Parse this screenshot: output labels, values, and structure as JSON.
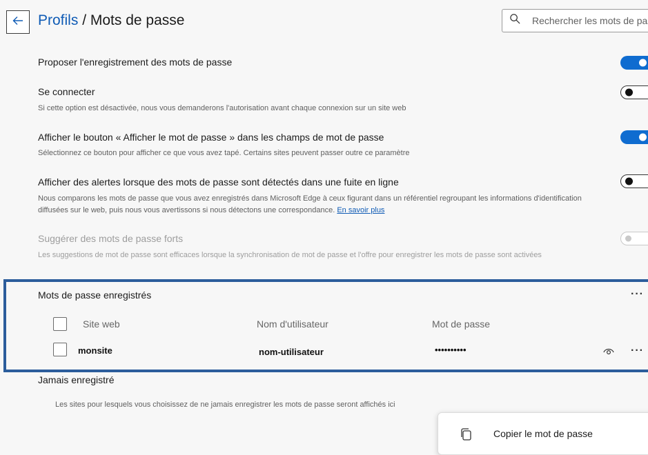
{
  "header": {
    "breadcrumb_link": "Profils",
    "breadcrumb_sep": " / ",
    "title": "Mots de passe",
    "search_placeholder": "Rechercher les mots de passe"
  },
  "settings": [
    {
      "title": "Proposer l'enregistrement des mots de passe",
      "state": "on"
    },
    {
      "title": "Se connecter",
      "description": "Si cette option est désactivée, nous vous demanderons l'autorisation avant chaque connexion sur un site web",
      "state": "off"
    },
    {
      "title": "Afficher le bouton « Afficher le mot de passe » dans les champs de mot de passe",
      "description": "Sélectionnez ce bouton pour afficher ce que vous avez tapé. Certains sites peuvent passer outre ce paramètre",
      "state": "on"
    },
    {
      "title": "Afficher des alertes lorsque des mots de passe sont détectés dans une fuite en ligne",
      "description": "Nous comparons les mots de passe que vous avez enregistrés dans Microsoft Edge à ceux figurant dans un référentiel regroupant les informations d'identification diffusées sur le web, puis nous vous avertissons si nous détectons une correspondance.",
      "link": "En savoir plus",
      "state": "off"
    },
    {
      "title": "Suggérer des mots de passe forts",
      "description": "Les suggestions de mot de passe sont efficaces lorsque la synchronisation de mot de passe et l'offre pour enregistrer les mots de passe sont activées",
      "state": "disabled"
    }
  ],
  "saved_passwords": {
    "title": "Mots de passe enregistrés",
    "more_label": "···",
    "columns": {
      "site": "Site web",
      "username": "Nom d'utilisateur",
      "password": "Mot de passe"
    },
    "rows": [
      {
        "site": "monsite",
        "username": "nom-utilisateur",
        "password": "••••••••••"
      }
    ]
  },
  "never_saved": {
    "title": "Jamais enregistré",
    "description": "Les sites pour lesquels vous choisissez de ne jamais enregistrer les mots de passe seront affichés ici"
  },
  "popup": {
    "label": "Copier le mot de passe"
  },
  "icons": {
    "back": "arrow-left-icon",
    "search": "search-icon",
    "eye": "eye-icon",
    "more": "more-horizontal-icon",
    "copy": "copy-icon"
  },
  "colors": {
    "accent": "#0f6cd0",
    "link": "#0f5bb5",
    "highlight_border": "#2c5d9c"
  }
}
